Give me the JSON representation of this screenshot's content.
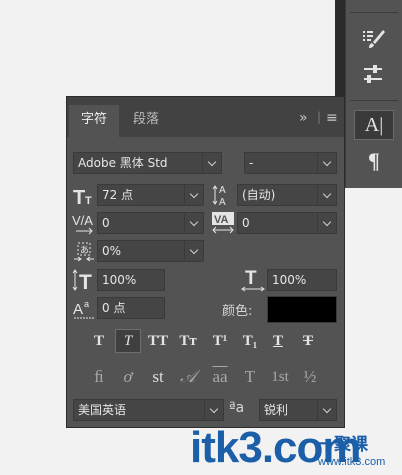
{
  "toolbar": {
    "items": [
      {
        "icon": "brush-icon"
      },
      {
        "icon": "adjust-icon"
      },
      {
        "icon": "character-panel-icon",
        "label": "A|"
      },
      {
        "icon": "paragraph-icon",
        "label": "¶"
      }
    ]
  },
  "panel": {
    "tabs": [
      {
        "label": "字符",
        "active": true
      },
      {
        "label": "段落",
        "active": false
      }
    ],
    "collapse_label": "»",
    "menu_label": "≡",
    "font_family": "Adobe 黑体 Std",
    "font_style": "-",
    "font_size": "72 点",
    "leading": "(自动)",
    "kerning": "0",
    "tracking": "0",
    "tsume": "0%",
    "vertical_scale": "100%",
    "horizontal_scale": "100%",
    "baseline_shift": "0 点",
    "color_label": "颜色:",
    "color": "#000000",
    "style_buttons": [
      {
        "name": "faux-bold-button",
        "label": "T"
      },
      {
        "name": "faux-italic-button",
        "label": "T",
        "active": true
      },
      {
        "name": "all-caps-button",
        "label": "TT"
      },
      {
        "name": "small-caps-button",
        "label": "Tт"
      },
      {
        "name": "superscript-button",
        "label": "T¹"
      },
      {
        "name": "subscript-button",
        "label": "T₁"
      },
      {
        "name": "underline-button",
        "label": "T"
      },
      {
        "name": "strikethrough-button",
        "label": "T"
      }
    ],
    "opentype_buttons": [
      {
        "name": "ligatures-button",
        "label": "ﬁ"
      },
      {
        "name": "discretionary-ligatures-button",
        "label": "ơ"
      },
      {
        "name": "contextual-alternates-button",
        "label": "st"
      },
      {
        "name": "swash-button",
        "label": "𝒜"
      },
      {
        "name": "stylistic-alternates-button",
        "label": "aa"
      },
      {
        "name": "titling-button",
        "label": "T"
      },
      {
        "name": "ordinals-button",
        "label": "1st"
      },
      {
        "name": "fractions-button",
        "label": "½"
      }
    ],
    "language": "美国英语",
    "aa_label": "ªa",
    "antialias": "锐利"
  },
  "watermark": {
    "main": "itk3.com",
    "cn": "一聚课",
    "sub": "www.itk3.com"
  }
}
